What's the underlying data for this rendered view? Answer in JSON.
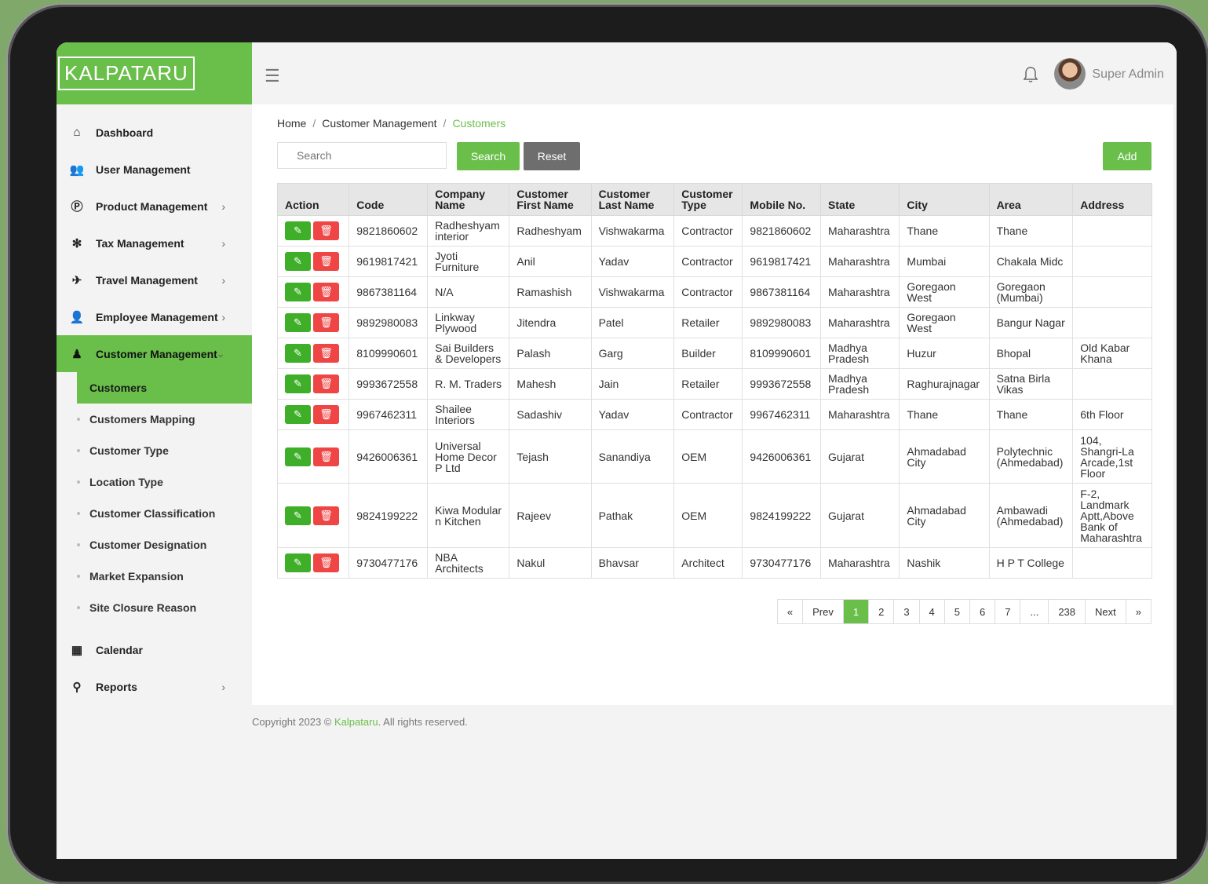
{
  "brand": {
    "logo": "KALPATARU"
  },
  "header": {
    "user_name": "Super Admin"
  },
  "sidebar": {
    "items": [
      {
        "label": "Dashboard",
        "icon": "home-icon",
        "chevron": false
      },
      {
        "label": "User Management",
        "icon": "users-icon",
        "chevron": false
      },
      {
        "label": "Product Management",
        "icon": "product-icon",
        "chevron": true
      },
      {
        "label": "Tax Management",
        "icon": "tax-icon",
        "chevron": true
      },
      {
        "label": "Travel Management",
        "icon": "plane-icon",
        "chevron": true
      },
      {
        "label": "Employee Management",
        "icon": "employee-icon",
        "chevron": true
      },
      {
        "label": "Customer Management",
        "icon": "customer-icon",
        "chevron": true
      }
    ],
    "customer_submenu": [
      "Customers",
      "Customers Mapping",
      "Customer Type",
      "Location Type",
      "Customer Classification",
      "Customer Designation",
      "Market Expansion",
      "Site Closure Reason"
    ],
    "bottom_items": [
      {
        "label": "Calendar",
        "icon": "calendar-icon"
      },
      {
        "label": "Reports",
        "icon": "reports-icon"
      }
    ]
  },
  "breadcrumb": {
    "home": "Home",
    "section": "Customer Management",
    "current": "Customers"
  },
  "toolbar": {
    "search_placeholder": "Search",
    "search_label": "Search",
    "reset_label": "Reset",
    "add_label": "Add"
  },
  "table": {
    "headers": [
      "Action",
      "Code",
      "Company Name",
      "Customer First Name",
      "Customer Last Name",
      "Customer Type",
      "Mobile No.",
      "State",
      "City",
      "Area",
      "Address"
    ],
    "rows": [
      [
        "9821860602",
        "Radheshyam interior",
        "Radheshyam",
        "Vishwakarma",
        "Contractor",
        "9821860602",
        "Maharashtra",
        "Thane",
        "Thane",
        ""
      ],
      [
        "9619817421",
        "Jyoti Furniture",
        "Anil",
        "Yadav",
        "Contractor",
        "9619817421",
        "Maharashtra",
        "Mumbai",
        "Chakala Midc",
        ""
      ],
      [
        "9867381164",
        "N/A",
        "Ramashish",
        "Vishwakarma",
        "Contractor",
        "9867381164",
        "Maharashtra",
        "Goregaon West",
        "Goregaon (Mumbai)",
        ""
      ],
      [
        "9892980083",
        "Linkway Plywood",
        "Jitendra",
        "Patel",
        "Retailer",
        "9892980083",
        "Maharashtra",
        "Goregaon West",
        "Bangur Nagar",
        ""
      ],
      [
        "8109990601",
        "Sai Builders & Developers",
        "Palash",
        "Garg",
        "Builder",
        "8109990601",
        "Madhya Pradesh",
        "Huzur",
        "Bhopal",
        "Old Kabar Khana"
      ],
      [
        "9993672558",
        "R. M. Traders",
        "Mahesh",
        "Jain",
        "Retailer",
        "9993672558",
        "Madhya Pradesh",
        "Raghurajnagar",
        "Satna Birla Vikas",
        ""
      ],
      [
        "9967462311",
        "Shailee Interiors",
        "Sadashiv",
        "Yadav",
        "Contractor",
        "9967462311",
        "Maharashtra",
        "Thane",
        "Thane",
        "6th Floor"
      ],
      [
        "9426006361",
        "Universal Home Decor P Ltd",
        "Tejash",
        "Sanandiya",
        "OEM",
        "9426006361",
        "Gujarat",
        "Ahmadabad City",
        "Polytechnic (Ahmedabad)",
        "104, Shangri-La Arcade,1st Floor"
      ],
      [
        "9824199222",
        "Kiwa Modular n Kitchen",
        "Rajeev",
        "Pathak",
        "OEM",
        "9824199222",
        "Gujarat",
        "Ahmadabad City",
        "Ambawadi (Ahmedabad)",
        "F-2, Landmark Aptt,Above Bank of Maharashtra"
      ],
      [
        "9730477176",
        "NBA Architects",
        "Nakul",
        "Bhavsar",
        "Architect",
        "9730477176",
        "Maharashtra",
        "Nashik",
        "H P T College",
        ""
      ]
    ]
  },
  "pagination": {
    "first": "«",
    "prev": "Prev",
    "pages": [
      "1",
      "2",
      "3",
      "4",
      "5",
      "6",
      "7",
      "...",
      "238"
    ],
    "current": "1",
    "next": "Next",
    "last": "»"
  },
  "footer": {
    "prefix": "Copyright 2023 © ",
    "brand": "Kalpataru",
    "suffix": ". All rights reserved."
  },
  "colors": {
    "accent": "#6abf4b",
    "danger": "#ef4545",
    "neutral_button": "#6e6e6e"
  }
}
